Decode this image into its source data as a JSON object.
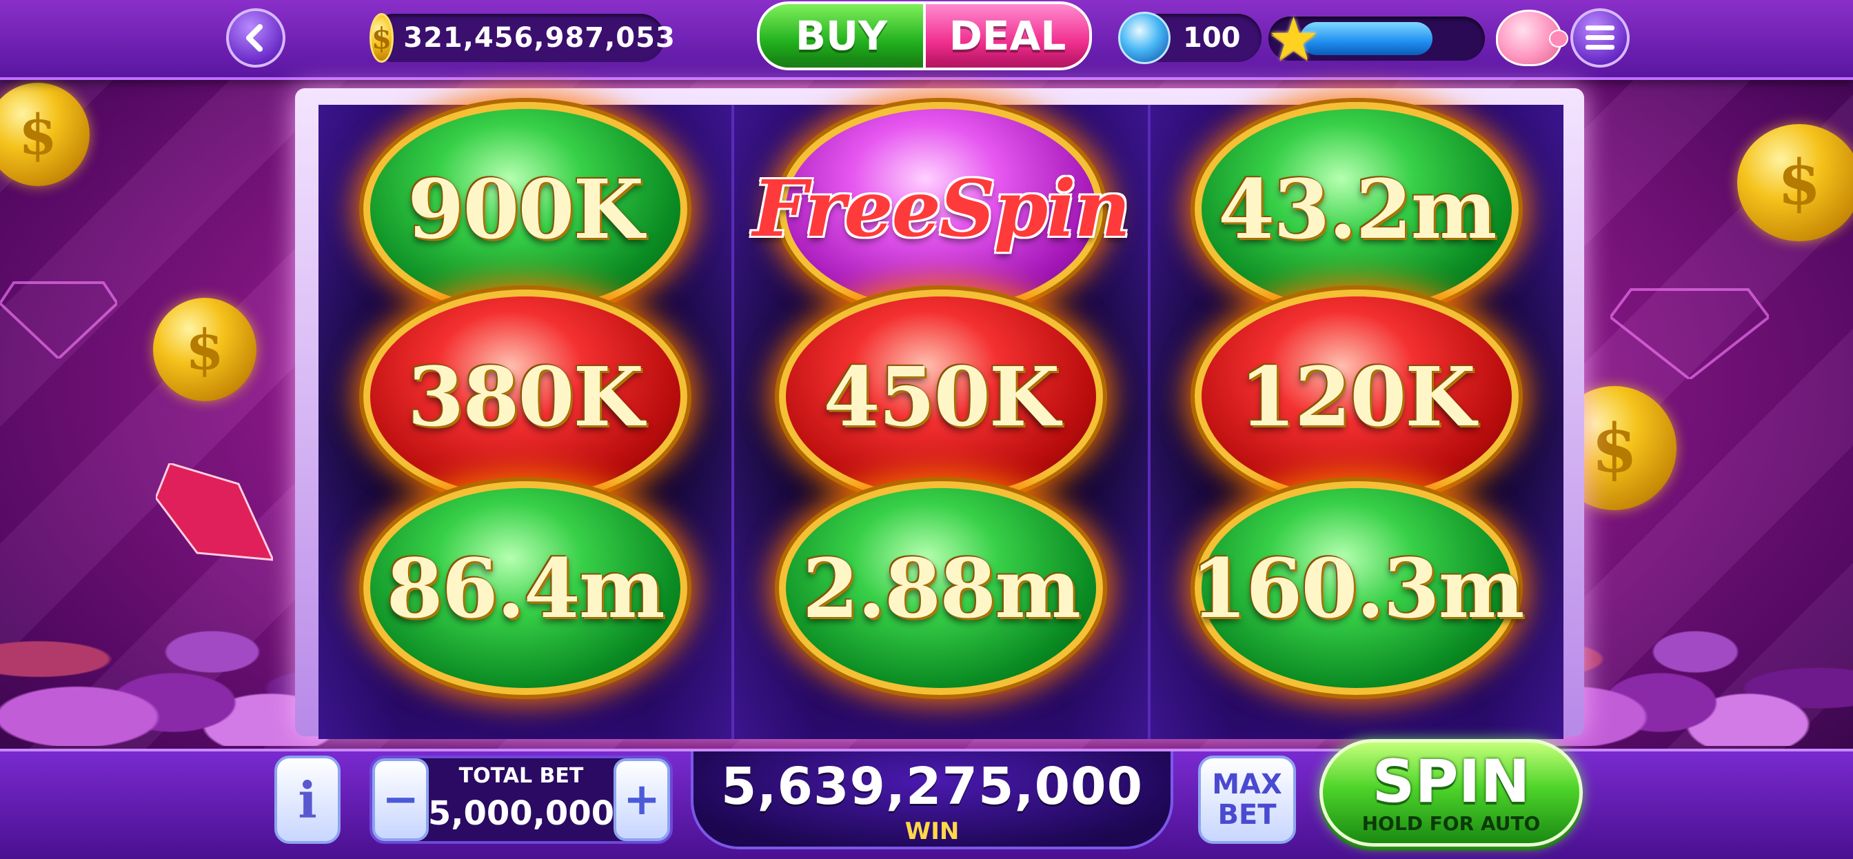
{
  "header": {
    "coin_balance": "321,456,987,053",
    "buy_label": "BUY",
    "deal_label": "DEAL",
    "gem_count": "100",
    "xp_progress": 0.74,
    "back_icon": "chevron-left-icon",
    "menu_icon": "hamburger-menu-icon",
    "piggy_icon": "piggy-bank-icon"
  },
  "reels": [
    {
      "symbols": [
        {
          "label": "900K",
          "color": "green"
        },
        {
          "label": "380K",
          "color": "red"
        },
        {
          "label": "86.4m",
          "color": "green"
        }
      ]
    },
    {
      "symbols": [
        {
          "label": "FreeSpin",
          "color": "pink"
        },
        {
          "label": "450K",
          "color": "red"
        },
        {
          "label": "2.88m",
          "color": "green"
        }
      ]
    },
    {
      "symbols": [
        {
          "label": "43.2m",
          "color": "green"
        },
        {
          "label": "120K",
          "color": "red"
        },
        {
          "label": "160.3m",
          "color": "green"
        }
      ]
    }
  ],
  "footer": {
    "info_label": "i",
    "minus_label": "−",
    "plus_label": "+",
    "total_bet_label": "TOTAL BET",
    "total_bet_value": "5,000,000",
    "win_value": "5,639,275,000",
    "win_label": "WIN",
    "max_bet_line1": "MAX",
    "max_bet_line2": "BET",
    "spin_label": "SPIN",
    "spin_sub_label": "HOLD FOR AUTO"
  },
  "colors": {
    "buy": "#22b01e",
    "deal": "#f0308e",
    "spin": "#4ed42a",
    "win_label": "#ffd84a"
  }
}
